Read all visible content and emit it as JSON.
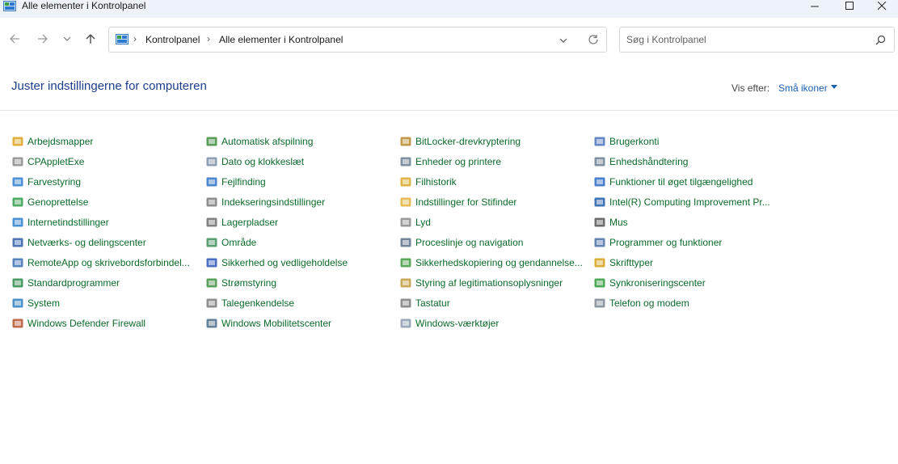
{
  "window": {
    "title": "Alle elementer i Kontrolpanel"
  },
  "nav": {
    "breadcrumb": [
      "Kontrolpanel",
      "Alle elementer i Kontrolpanel"
    ],
    "search_placeholder": "Søg i Kontrolpanel"
  },
  "header": {
    "title": "Juster indstillingerne for computeren",
    "view_by_label": "Vis efter:",
    "view_by_value": "Små ikoner"
  },
  "items": [
    {
      "label": "Arbejdsmapper",
      "icon": "work-folders-icon",
      "color": "#d9a21b"
    },
    {
      "label": "CPAppletExe",
      "icon": "document-icon",
      "color": "#8a8a8a"
    },
    {
      "label": "Farvestyring",
      "icon": "color-management-icon",
      "color": "#2e7fd1"
    },
    {
      "label": "Genoprettelse",
      "icon": "recovery-icon",
      "color": "#2e9c4a"
    },
    {
      "label": "Internetindstillinger",
      "icon": "internet-options-icon",
      "color": "#2c7fd0"
    },
    {
      "label": "Netværks- og delingscenter",
      "icon": "network-icon",
      "color": "#2f5fa8"
    },
    {
      "label": "RemoteApp og skrivebordsforbindel...",
      "icon": "remoteapp-icon",
      "color": "#3a6fb3"
    },
    {
      "label": "Standardprogrammer",
      "icon": "default-programs-icon",
      "color": "#2e8b4a"
    },
    {
      "label": "System",
      "icon": "system-icon",
      "color": "#2d7fc1"
    },
    {
      "label": "Windows Defender Firewall",
      "icon": "firewall-icon",
      "color": "#b5532b"
    },
    {
      "label": "Automatisk afspilning",
      "icon": "autoplay-icon",
      "color": "#3c8c3c"
    },
    {
      "label": "Dato og klokkeslæt",
      "icon": "date-time-icon",
      "color": "#7d8fa6"
    },
    {
      "label": "Fejlfinding",
      "icon": "troubleshooting-icon",
      "color": "#2b6fc7"
    },
    {
      "label": "Indekseringsindstillinger",
      "icon": "indexing-icon",
      "color": "#7a7a7a"
    },
    {
      "label": "Lagerpladser",
      "icon": "storage-spaces-icon",
      "color": "#6d6d6d"
    },
    {
      "label": "Område",
      "icon": "region-icon",
      "color": "#3e8e5c"
    },
    {
      "label": "Sikkerhed og vedligeholdelse",
      "icon": "security-flag-icon",
      "color": "#2a56b8"
    },
    {
      "label": "Strømstyring",
      "icon": "power-options-icon",
      "color": "#3f8f3f"
    },
    {
      "label": "Talegenkendelse",
      "icon": "microphone-icon",
      "color": "#7a7a7a"
    },
    {
      "label": "Windows Mobilitetscenter",
      "icon": "mobility-center-icon",
      "color": "#4a6a8a"
    },
    {
      "label": "BitLocker-drevkryptering",
      "icon": "bitlocker-icon",
      "color": "#b58a2c"
    },
    {
      "label": "Enheder og printere",
      "icon": "devices-printers-icon",
      "color": "#6a7f92"
    },
    {
      "label": "Filhistorik",
      "icon": "file-history-icon",
      "color": "#d8a826"
    },
    {
      "label": "Indstillinger for Stifinder",
      "icon": "explorer-options-icon",
      "color": "#e0b23a"
    },
    {
      "label": "Lyd",
      "icon": "sound-icon",
      "color": "#8a8a8a"
    },
    {
      "label": "Proceslinje og navigation",
      "icon": "taskbar-icon",
      "color": "#5a6f86"
    },
    {
      "label": "Sikkerhedskopiering og gendannelse...",
      "icon": "backup-restore-icon",
      "color": "#3f9a3f"
    },
    {
      "label": "Styring af legitimationsoplysninger",
      "icon": "credential-manager-icon",
      "color": "#c09a3a"
    },
    {
      "label": "Tastatur",
      "icon": "keyboard-icon",
      "color": "#7a7a7a"
    },
    {
      "label": "Windows-værktøjer",
      "icon": "windows-tools-icon",
      "color": "#8a9aab"
    },
    {
      "label": "Brugerkonti",
      "icon": "user-accounts-icon",
      "color": "#4a72b8"
    },
    {
      "label": "Enhedshåndtering",
      "icon": "device-manager-icon",
      "color": "#6a7f92"
    },
    {
      "label": "Funktioner til øget tilgængelighed",
      "icon": "ease-of-access-icon",
      "color": "#2b66c4"
    },
    {
      "label": "Intel(R) Computing Improvement Pr...",
      "icon": "intel-icon",
      "color": "#1f5aa8"
    },
    {
      "label": "Mus",
      "icon": "mouse-icon",
      "color": "#555555"
    },
    {
      "label": "Programmer og funktioner",
      "icon": "programs-features-icon",
      "color": "#4a6fa5"
    },
    {
      "label": "Skrifttyper",
      "icon": "fonts-icon",
      "color": "#d4a017"
    },
    {
      "label": "Synkroniseringscenter",
      "icon": "sync-center-icon",
      "color": "#2f9a3a"
    },
    {
      "label": "Telefon og modem",
      "icon": "phone-modem-icon",
      "color": "#7a8794"
    }
  ]
}
